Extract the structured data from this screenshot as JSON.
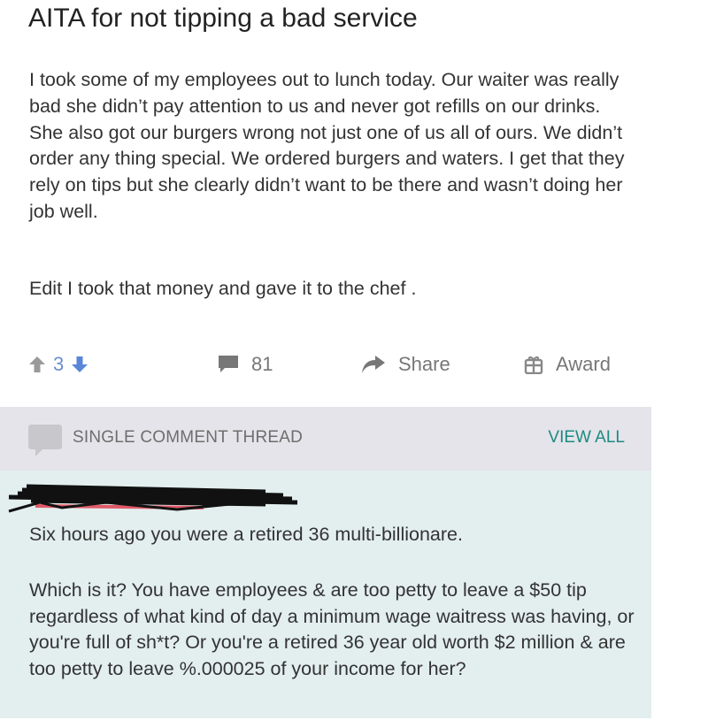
{
  "post": {
    "title": "AITA for not tipping a bad service",
    "body": "I took some of my employees out to lunch today. Our waiter was really bad she didn’t pay attention to us and never got refills on our drinks. She also got our burgers wrong not just one of us all of ours. We didn’t order any thing special. We ordered burgers and waters. I get that they rely on tips but she clearly didn’t want to be there and wasn’t doing her job well.",
    "edit": "Edit I took that money and gave it to the chef ."
  },
  "actions": {
    "vote_count": "3",
    "comment_count": "81",
    "share_label": "Share",
    "award_label": "Award"
  },
  "thread": {
    "label": "SINGLE COMMENT THREAD",
    "view_all": "VIEW ALL",
    "comment_line1": "Six hours ago you were a retired 36 multi-billionare.",
    "comment_line2": "Which is it? You have employees & are too petty to leave a $50 tip regardless of what kind of day a minimum wage waitress was having, or you're full of sh*t? Or you're a retired 36 year old worth $2 million & are too petty to leave %.000025 of your income for her?"
  },
  "colors": {
    "vote_blue": "#6a8fd0",
    "view_all_teal": "#1e8a82",
    "thread_bg": "#e3eeee",
    "thread_header_bg": "#e4e4ea"
  },
  "icons": [
    "upvote-arrow-icon",
    "downvote-arrow-icon",
    "comment-bubble-icon",
    "share-arrow-icon",
    "award-gift-icon"
  ]
}
